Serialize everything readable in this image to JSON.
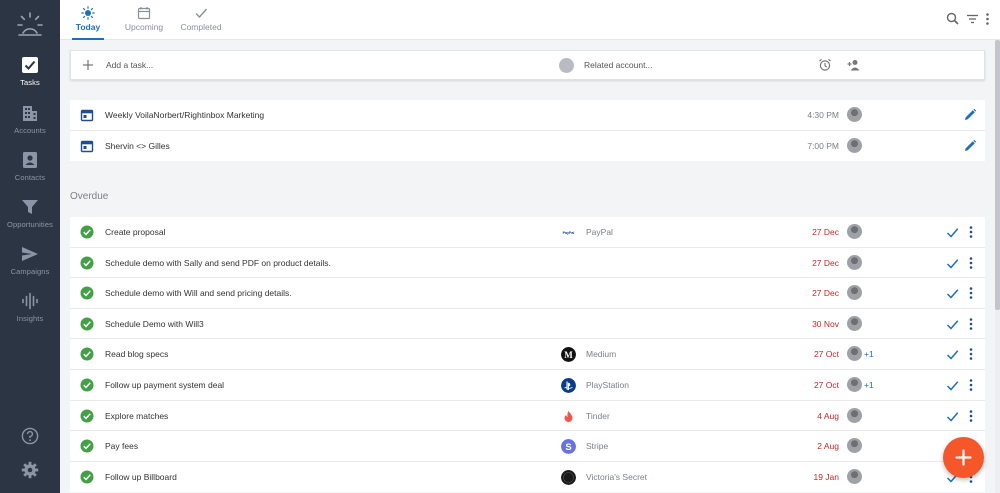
{
  "sidebar": {
    "items": [
      {
        "label": "Tasks",
        "icon": "check-square-icon"
      },
      {
        "label": "Accounts",
        "icon": "building-icon"
      },
      {
        "label": "Contacts",
        "icon": "contact-card-icon"
      },
      {
        "label": "Opportunities",
        "icon": "funnel-icon"
      },
      {
        "label": "Campaigns",
        "icon": "send-icon"
      },
      {
        "label": "Insights",
        "icon": "sound-wave-icon"
      }
    ],
    "active": "Tasks"
  },
  "tabs": [
    {
      "label": "Today",
      "icon": "sun-icon"
    },
    {
      "label": "Upcoming",
      "icon": "calendar-icon"
    },
    {
      "label": "Completed",
      "icon": "check-icon"
    }
  ],
  "addbar": {
    "task_placeholder": "Add a task...",
    "account_placeholder": "Related account..."
  },
  "today": [
    {
      "title": "Weekly VoilaNorbert/Rightinbox Marketing",
      "time": "4:30 PM"
    },
    {
      "title": "Shervin <> Gilles",
      "time": "7:00 PM"
    }
  ],
  "overdue_title": "Overdue",
  "overdue": [
    {
      "title": "Create proposal",
      "company": "PayPal",
      "date": "27 Dec",
      "extra": ""
    },
    {
      "title": "Schedule demo with Sally and send PDF on product details.",
      "company": "",
      "date": "27 Dec",
      "extra": ""
    },
    {
      "title": "Schedule demo with Will and send pricing details.",
      "company": "",
      "date": "27 Dec",
      "extra": ""
    },
    {
      "title": "Schedule Demo with Will3",
      "company": "",
      "date": "30 Nov",
      "extra": ""
    },
    {
      "title": "Read blog specs",
      "company": "Medium",
      "date": "27 Oct",
      "extra": "+1"
    },
    {
      "title": "Follow up payment system deal",
      "company": "PlayStation",
      "date": "27 Oct",
      "extra": "+1"
    },
    {
      "title": "Explore matches",
      "company": "Tinder",
      "date": "4 Aug",
      "extra": ""
    },
    {
      "title": "Pay fees",
      "company": "Stripe",
      "date": "2 Aug",
      "extra": ""
    },
    {
      "title": "Follow up Billboard",
      "company": "Victoria's Secret",
      "date": "19 Jan",
      "extra": ""
    }
  ],
  "colors": {
    "sidebar_bg": "#2b3544",
    "accent_blue": "#1f6fb5",
    "overdue_red": "#c62828",
    "complete_green": "#43a047",
    "fab_orange": "#f5572b"
  }
}
